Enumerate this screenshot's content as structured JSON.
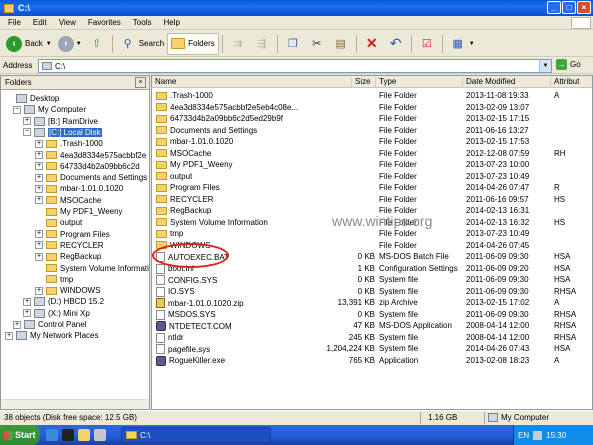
{
  "window": {
    "title": "C:\\"
  },
  "menu": [
    "File",
    "Edit",
    "View",
    "Favorites",
    "Tools",
    "Help"
  ],
  "toolbar": {
    "back": "Back",
    "search": "Search",
    "folders": "Folders"
  },
  "address": {
    "label": "Address",
    "value": "C:\\",
    "go": "Go"
  },
  "folders_pane": {
    "title": "Folders",
    "tree": [
      {
        "label": "Desktop",
        "pm": "",
        "icon": "desktop"
      },
      {
        "label": "My Computer",
        "pm": "−",
        "icon": "computer"
      },
      {
        "label": "[B:] RamDrive",
        "pm": "+",
        "icon": "drive"
      },
      {
        "label": "[C:] Local Disk",
        "pm": "−",
        "icon": "drive",
        "selected": true
      },
      {
        "label": ".Trash-1000",
        "pm": "+",
        "icon": "folder"
      },
      {
        "label": "4ea3d8334e575acbbf2e",
        "pm": "+",
        "icon": "folder"
      },
      {
        "label": "64733d4b2a09bb6c2d",
        "pm": "+",
        "icon": "folder"
      },
      {
        "label": "Documents and Settings",
        "pm": "+",
        "icon": "folder"
      },
      {
        "label": "mbar-1.01.0.1020",
        "pm": "+",
        "icon": "folder"
      },
      {
        "label": "MSOCache",
        "pm": "+",
        "icon": "folder"
      },
      {
        "label": "My PDF1_Weeny",
        "pm": "",
        "icon": "folder"
      },
      {
        "label": "output",
        "pm": "",
        "icon": "folder"
      },
      {
        "label": "Program Files",
        "pm": "+",
        "icon": "folder"
      },
      {
        "label": "RECYCLER",
        "pm": "+",
        "icon": "folder"
      },
      {
        "label": "RegBackup",
        "pm": "+",
        "icon": "folder"
      },
      {
        "label": "System Volume Informati",
        "pm": "",
        "icon": "folder"
      },
      {
        "label": "tmp",
        "pm": "",
        "icon": "folder"
      },
      {
        "label": "WINDOWS",
        "pm": "+",
        "icon": "folder"
      },
      {
        "label": "(D:) HBCD 15.2",
        "pm": "+",
        "icon": "drive"
      },
      {
        "label": "(X:) Mini Xp",
        "pm": "+",
        "icon": "drive"
      },
      {
        "label": "Control Panel",
        "pm": "+",
        "icon": "control"
      },
      {
        "label": "My Network Places",
        "pm": "+",
        "icon": "network"
      }
    ]
  },
  "columns": {
    "name": "Name",
    "size": "Size",
    "type": "Type",
    "date": "Date Modified",
    "attr": "Attribut"
  },
  "files": [
    {
      "name": ".Trash-1000",
      "size": "",
      "type": "File Folder",
      "date": "2013-11-08 19:33",
      "attr": "A",
      "icon": "folder"
    },
    {
      "name": "4ea3d8334e575acbbf2e5eb4c08e...",
      "size": "",
      "type": "File Folder",
      "date": "2013-02-09 13:07",
      "attr": "",
      "icon": "folder"
    },
    {
      "name": "64733d4b2a09bb6c2d5ed29b9f",
      "size": "",
      "type": "File Folder",
      "date": "2013-02-15 17:15",
      "attr": "",
      "icon": "folder"
    },
    {
      "name": "Documents and Settings",
      "size": "",
      "type": "File Folder",
      "date": "2011-06-16 13:27",
      "attr": "",
      "icon": "folder"
    },
    {
      "name": "mbar-1.01.0.1020",
      "size": "",
      "type": "File Folder",
      "date": "2013-02-15 17:53",
      "attr": "",
      "icon": "folder"
    },
    {
      "name": "MSOCache",
      "size": "",
      "type": "File Folder",
      "date": "2012-12-08 07:59",
      "attr": "RH",
      "icon": "folder"
    },
    {
      "name": "My PDF1_Weeny",
      "size": "",
      "type": "File Folder",
      "date": "2013-07-23 10:00",
      "attr": "",
      "icon": "folder"
    },
    {
      "name": "output",
      "size": "",
      "type": "File Folder",
      "date": "2013-07-23 10:49",
      "attr": "",
      "icon": "folder"
    },
    {
      "name": "Program Files",
      "size": "",
      "type": "File Folder",
      "date": "2014-04-26 07:47",
      "attr": "R",
      "icon": "folder"
    },
    {
      "name": "RECYCLER",
      "size": "",
      "type": "File Folder",
      "date": "2011-06-16 09:57",
      "attr": "HS",
      "icon": "folder"
    },
    {
      "name": "RegBackup",
      "size": "",
      "type": "File Folder",
      "date": "2014-02-13 16:31",
      "attr": "",
      "icon": "folder"
    },
    {
      "name": "System Volume Information",
      "size": "",
      "type": "File Folder",
      "date": "2014-02-13 16:32",
      "attr": "HS",
      "icon": "folder"
    },
    {
      "name": "tmp",
      "size": "",
      "type": "File Folder",
      "date": "2013-07-23 10:49",
      "attr": "",
      "icon": "folder"
    },
    {
      "name": "WINDOWS",
      "size": "",
      "type": "File Folder",
      "date": "2014-04-26 07:45",
      "attr": "",
      "icon": "folder"
    },
    {
      "name": "AUTOEXEC.BAT",
      "size": "0 KB",
      "type": "MS-DOS Batch File",
      "date": "2011-06-09 09:30",
      "attr": "HSA",
      "icon": "file"
    },
    {
      "name": "boot.ini",
      "size": "1 KB",
      "type": "Configuration Settings",
      "date": "2011-06-09 09:20",
      "attr": "HSA",
      "icon": "file"
    },
    {
      "name": "CONFIG.SYS",
      "size": "0 KB",
      "type": "System file",
      "date": "2011-06-09 09:30",
      "attr": "HSA",
      "icon": "file"
    },
    {
      "name": "IO.SYS",
      "size": "0 KB",
      "type": "System file",
      "date": "2011-06-09 09:30",
      "attr": "RHSA",
      "icon": "file"
    },
    {
      "name": "mbar-1.01.0.1020.zip",
      "size": "13,391 KB",
      "type": "zip Archive",
      "date": "2013-02-15 17:02",
      "attr": "A",
      "icon": "zip"
    },
    {
      "name": "MSDOS.SYS",
      "size": "0 KB",
      "type": "System file",
      "date": "2011-06-09 09:30",
      "attr": "RHSA",
      "icon": "file"
    },
    {
      "name": "NTDETECT.COM",
      "size": "47 KB",
      "type": "MS-DOS Application",
      "date": "2008-04-14 12:00",
      "attr": "RHSA",
      "icon": "app"
    },
    {
      "name": "ntldr",
      "size": "245 KB",
      "type": "System file",
      "date": "2008-04-14 12:00",
      "attr": "RHSA",
      "icon": "file"
    },
    {
      "name": "pagefile.sys",
      "size": "1,204,224 KB",
      "type": "System file",
      "date": "2014-04-26 07:43",
      "attr": "HSA",
      "icon": "file"
    },
    {
      "name": "RogueKiller.exe",
      "size": "765 KB",
      "type": "Application",
      "date": "2013-02-08 18:23",
      "attr": "A",
      "icon": "app"
    }
  ],
  "watermark": "www.wintips.org",
  "status": {
    "objects": "38 objects (Disk free space: 12.5 GB)",
    "size": "1.16 GB",
    "location": "My Computer"
  },
  "taskbar": {
    "start": "Start",
    "task": "C:\\",
    "lang": "EN",
    "clock": "15:30"
  }
}
